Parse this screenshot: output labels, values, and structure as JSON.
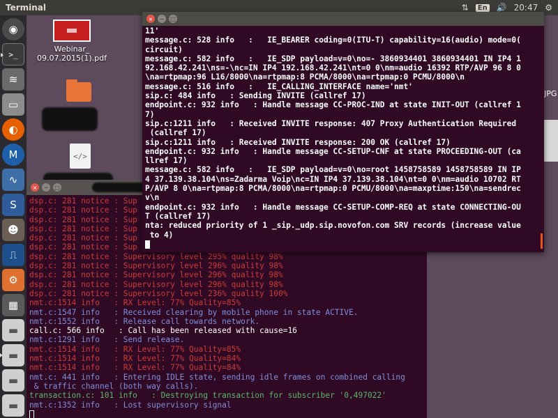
{
  "topbar": {
    "title": "Terminal",
    "lang": "En",
    "clock": "20:47"
  },
  "desktop": {
    "icons": [
      {
        "label": "Webinar_\n09.07.2015(1).pdf"
      },
      {
        "label": ""
      },
      {
        "label": ""
      }
    ],
    "side_label": "JPG"
  },
  "front_terminal": {
    "lines": [
      {
        "color": "white",
        "text": "11'"
      },
      {
        "color": "white",
        "text": "message.c: 528 info   :   IE_BEARER coding=0(ITU-T) capability=16(audio) mode=0("
      },
      {
        "color": "white",
        "text": "circuit)"
      },
      {
        "color": "white",
        "text": "message.c: 582 info   :   IE_SDP payload=v=0\\no=- 3860934401 3860934401 IN IP4 1"
      },
      {
        "color": "white",
        "text": "92.168.42.241\\ns=-\\nc=IN IP4 192.168.42.241\\nt=0 0\\nm=audio 16392 RTP/AVP 96 8 0"
      },
      {
        "color": "white",
        "text": "\\na=rtpmap:96 L16/8000\\na=rtpmap:8 PCMA/8000\\na=rtpmap:0 PCMU/8000\\n"
      },
      {
        "color": "white",
        "text": "message.c: 516 info   :   IE_CALLING_INTERFACE name='nmt'"
      },
      {
        "color": "white",
        "text": "sip.c: 484 info   : Sending INVITE (callref 17)"
      },
      {
        "color": "white",
        "text": "endpoint.c: 932 info   : Handle message CC-PROC-IND at state INIT-OUT (callref 1"
      },
      {
        "color": "white",
        "text": "7)"
      },
      {
        "color": "white",
        "text": "sip.c:1211 info   : Received INVITE response: 407 Proxy Authentication Required"
      },
      {
        "color": "white",
        "text": " (callref 17)"
      },
      {
        "color": "white",
        "text": "sip.c:1211 info   : Received INVITE response: 200 OK (callref 17)"
      },
      {
        "color": "white",
        "text": "endpoint.c: 932 info   : Handle message CC-SETUP-CNF at state PROCEEDING-OUT (ca"
      },
      {
        "color": "white",
        "text": "llref 17)"
      },
      {
        "color": "white",
        "text": "message.c: 582 info   :   IE_SDP payload=v=0\\no=root 1458758589 1458758589 IN IP"
      },
      {
        "color": "white",
        "text": "4 37.139.38.104\\ns=Zadarma Voip\\nc=IN IP4 37.139.38.104\\nt=0 0\\nm=audio 10702 RT"
      },
      {
        "color": "white",
        "text": "P/AVP 8 0\\na=rtpmap:8 PCMA/8000\\na=rtpmap:0 PCMU/8000\\na=maxptime:150\\na=sendrec"
      },
      {
        "color": "white",
        "text": "v\\n"
      },
      {
        "color": "white",
        "text": "endpoint.c: 932 info   : Handle message CC-SETUP-COMP-REQ at state CONNECTING-OU"
      },
      {
        "color": "white",
        "text": "T (callref 17)"
      },
      {
        "color": "white",
        "text": "nta: reduced priority of 1 _sip._udp.sip.novofon.com SRV records (increase value"
      },
      {
        "color": "white",
        "text": " to 4)"
      }
    ]
  },
  "back_terminal": {
    "lines": [
      {
        "color": "red",
        "text": "dsp.c: 281 notice : Sup"
      },
      {
        "color": "red",
        "text": "dsp.c: 281 notice : Sup"
      },
      {
        "color": "red",
        "text": "dsp.c: 281 notice : Sup"
      },
      {
        "color": "red",
        "text": "dsp.c: 281 notice : Sup"
      },
      {
        "color": "red",
        "text": "dsp.c: 281 notice : Sup"
      },
      {
        "color": "red",
        "text": "dsp.c: 281 notice : Sup"
      },
      {
        "color": "red",
        "text": "dsp.c: 281 notice : Supervisory level 295% quality 98%"
      },
      {
        "color": "red",
        "text": "dsp.c: 281 notice : Supervisory level 296% quality 98%"
      },
      {
        "color": "red",
        "text": "dsp.c: 281 notice : Supervisory level 296% quality 98%"
      },
      {
        "color": "red",
        "text": "dsp.c: 281 notice : Supervisory level 296% quality 98%"
      },
      {
        "color": "red",
        "text": "dsp.c: 281 notice : Supervisory level 236% quality 100%"
      },
      {
        "color": "red",
        "text": "nmt.c:1514 info   : RX Level: 77% Quality=85%"
      },
      {
        "color": "blue",
        "text": "nmt.c:1547 info   : Received clearing by mobile phone in state ACTIVE."
      },
      {
        "color": "blue",
        "text": "nmt.c:1552 info   : Release call towards network."
      },
      {
        "color": "white",
        "text": "call.c: 566 info   : Call has been released with cause=16"
      },
      {
        "color": "blue",
        "text": "nmt.c:1291 info   : Send release."
      },
      {
        "color": "red",
        "text": "nmt.c:1514 info   : RX Level: 77% Quality=85%"
      },
      {
        "color": "red",
        "text": "nmt.c:1514 info   : RX Level: 77% Quality=84%"
      },
      {
        "color": "red",
        "text": "nmt.c:1514 info   : RX Level: 77% Quality=84%"
      },
      {
        "color": "blue",
        "text": "nmt.c: 441 info   : Entering IDLE state, sending idle frames on combined calling"
      },
      {
        "color": "blue",
        "text": " & traffic channel (both way calls)."
      },
      {
        "color": "green",
        "text": "transaction.c: 101 info   : Destroying transaction for subscriber '0,497022'"
      },
      {
        "color": "blue",
        "text": "nmt.c:1352 info   : Lost supervisory signal"
      }
    ]
  }
}
